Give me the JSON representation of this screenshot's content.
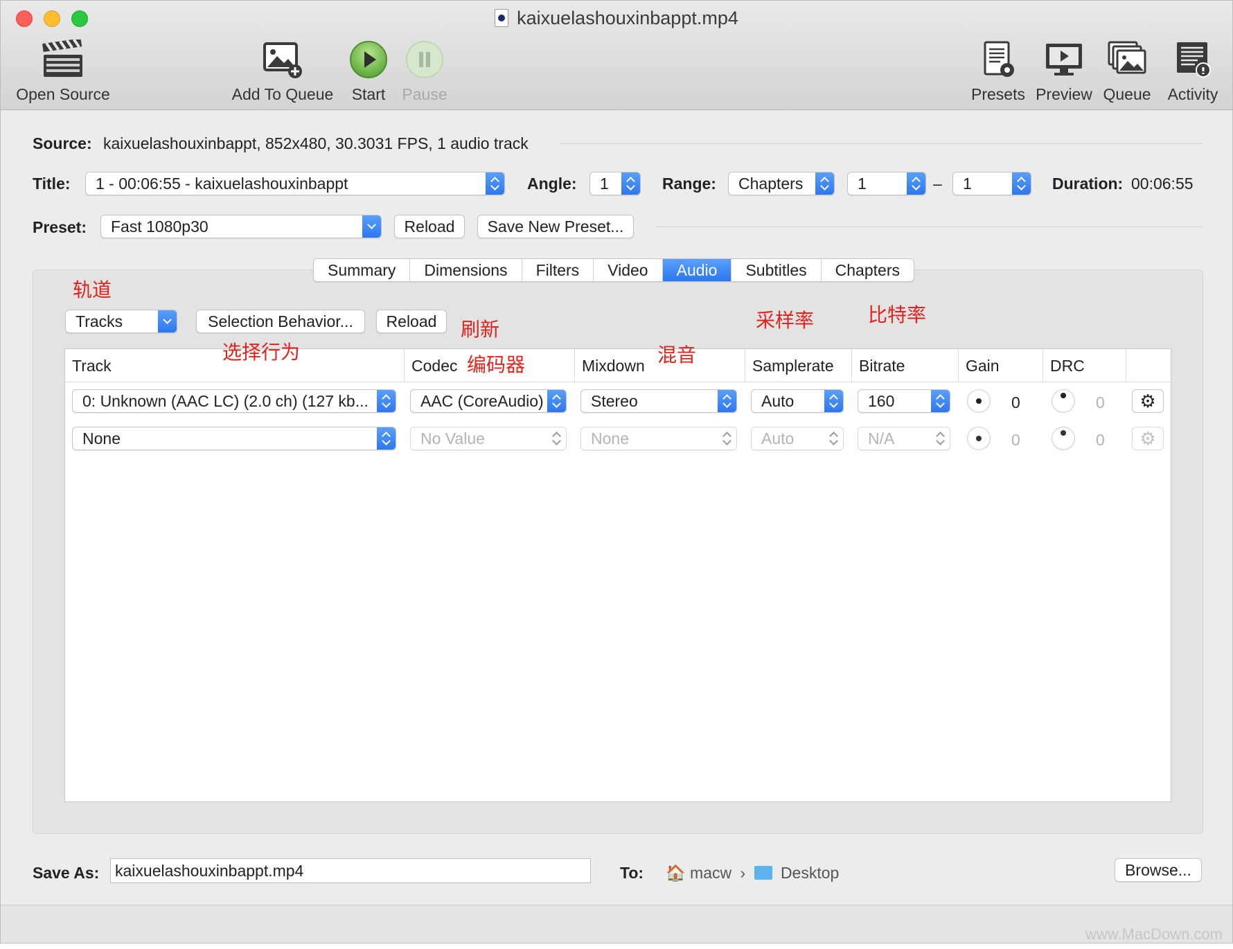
{
  "window": {
    "title": "kaixuelashouxinbappt.mp4"
  },
  "toolbar": {
    "open_source": "Open Source",
    "add_to_queue": "Add To Queue",
    "start": "Start",
    "pause": "Pause",
    "presets": "Presets",
    "preview": "Preview",
    "queue": "Queue",
    "activity": "Activity"
  },
  "source": {
    "label": "Source:",
    "value": "kaixuelashouxinbappt, 852x480, 30.3031 FPS, 1 audio track"
  },
  "title_row": {
    "title_label": "Title:",
    "title_value": "1 - 00:06:55 - kaixuelashouxinbappt",
    "angle_label": "Angle:",
    "angle_value": "1",
    "range_label": "Range:",
    "range_value": "Chapters",
    "range_start": "1",
    "range_dash": "–",
    "range_end": "1",
    "duration_label": "Duration:",
    "duration_value": "00:06:55"
  },
  "preset_row": {
    "label": "Preset:",
    "value": "Fast 1080p30",
    "reload": "Reload",
    "save_new": "Save New Preset..."
  },
  "tabs": [
    "Summary",
    "Dimensions",
    "Filters",
    "Video",
    "Audio",
    "Subtitles",
    "Chapters"
  ],
  "active_tab": "Audio",
  "audio": {
    "tracks_popup": "Tracks",
    "selection_behavior": "Selection Behavior...",
    "reload": "Reload",
    "columns": {
      "track": "Track",
      "codec": "Codec",
      "mixdown": "Mixdown",
      "samplerate": "Samplerate",
      "bitrate": "Bitrate",
      "gain": "Gain",
      "drc": "DRC"
    },
    "rows": [
      {
        "track": "0: Unknown (AAC LC) (2.0 ch) (127 kb...",
        "codec": "AAC (CoreAudio)",
        "mixdown": "Stereo",
        "samplerate": "Auto",
        "bitrate": "160",
        "gain": "0",
        "drc": "0"
      },
      {
        "track": "None",
        "codec": "No Value",
        "mixdown": "None",
        "samplerate": "Auto",
        "bitrate": "N/A",
        "gain": "0",
        "drc": "0"
      }
    ]
  },
  "annotations": {
    "tracks": "轨道",
    "selection": "选择行为",
    "refresh": "刷新",
    "codec": "编码器",
    "mixdown": "混音",
    "samplerate": "采样率",
    "bitrate": "比特率"
  },
  "save": {
    "label": "Save As:",
    "filename": "kaixuelashouxinbappt.mp4",
    "to_label": "To:",
    "path_home": "macw",
    "path_sep": "›",
    "path_folder": "Desktop",
    "browse": "Browse..."
  },
  "watermark": "www.MacDown.com",
  "colors": {
    "accent": "#2c76ef",
    "annotation": "#e0231c"
  }
}
